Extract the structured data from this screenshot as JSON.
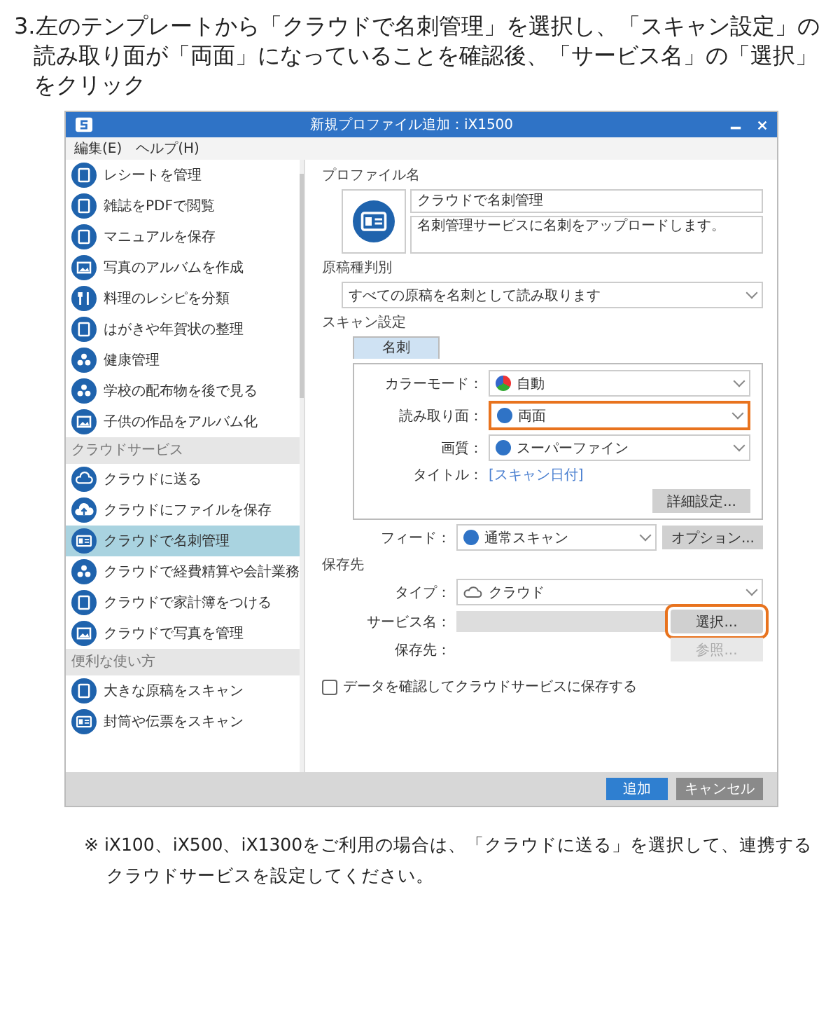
{
  "instruction": "3.左のテンプレートから「クラウドで名刺管理」を選択し、「スキャン設定」の読み取り面が「両面」になっていることを確認後、「サービス名」の「選択」をクリック",
  "window": {
    "title": "新規プロファイル追加：iX1500",
    "menu": [
      "編集(E)",
      "ヘルプ(H)"
    ]
  },
  "sidebar": [
    {
      "items": [
        {
          "label": "レシートを管理",
          "kind": "doc",
          "selected": false
        },
        {
          "label": "雑誌をPDFで閲覧",
          "kind": "doc",
          "selected": false
        },
        {
          "label": "マニュアルを保存",
          "kind": "doc",
          "selected": false
        },
        {
          "label": "写真のアルバムを作成",
          "kind": "photo",
          "selected": false
        },
        {
          "label": "料理のレシピを分類",
          "kind": "cutlery",
          "selected": false
        },
        {
          "label": "はがきや年賀状の整理",
          "kind": "doc",
          "selected": false
        },
        {
          "label": "健康管理",
          "kind": "people",
          "selected": false
        },
        {
          "label": "学校の配布物を後で見る",
          "kind": "people",
          "selected": false
        },
        {
          "label": "子供の作品をアルバム化",
          "kind": "photo",
          "selected": false
        }
      ]
    },
    {
      "header": "クラウドサービス",
      "items": [
        {
          "label": "クラウドに送る",
          "kind": "cloud",
          "selected": false
        },
        {
          "label": "クラウドにファイルを保存",
          "kind": "upload",
          "selected": false
        },
        {
          "label": "クラウドで名刺管理",
          "kind": "card",
          "selected": true
        },
        {
          "label": "クラウドで経費精算や会計業務",
          "kind": "people",
          "selected": false
        },
        {
          "label": "クラウドで家計簿をつける",
          "kind": "doc",
          "selected": false
        },
        {
          "label": "クラウドで写真を管理",
          "kind": "photo",
          "selected": false
        }
      ]
    },
    {
      "header": "便利な使い方",
      "items": [
        {
          "label": "大きな原稿をスキャン",
          "kind": "doc",
          "selected": false
        },
        {
          "label": "封筒や伝票をスキャン",
          "kind": "card",
          "selected": false
        }
      ]
    }
  ],
  "profile": {
    "heading": "プロファイル名",
    "name": "クラウドで名刺管理",
    "description": "名刺管理サービスに名刺をアップロードします。"
  },
  "document_type": {
    "heading": "原稿種判別",
    "value": "すべての原稿を名刺として読み取ります"
  },
  "scan_settings": {
    "heading": "スキャン設定",
    "tabs": [
      {
        "label": "名刺",
        "selected": true
      }
    ],
    "rows": [
      {
        "label": "カラーモード：",
        "kind": "select",
        "value": "自動",
        "highlighted": false
      },
      {
        "label": "読み取り面：",
        "kind": "select",
        "value": "両面",
        "highlighted": true
      },
      {
        "label": "画質：",
        "kind": "select",
        "value": "スーパーファイン",
        "highlighted": false
      },
      {
        "label": "タイトル：",
        "kind": "link",
        "value": "[スキャン日付]",
        "highlighted": false
      }
    ],
    "details_button": "詳細設定..."
  },
  "feed": {
    "label": "フィード：",
    "value": "通常スキャン",
    "button": "オプション..."
  },
  "destination": {
    "heading": "保存先",
    "rows": [
      {
        "label": "タイプ：",
        "kind": "select",
        "value": "クラウド"
      },
      {
        "label": "サービス名：",
        "kind": "field",
        "button": "選択...",
        "button_disabled": false,
        "highlighted": true
      },
      {
        "label": "保存先：",
        "kind": "blank",
        "button": "参照...",
        "button_disabled": true,
        "highlighted": false
      }
    ]
  },
  "confirm_checkbox": {
    "label": "データを確認してクラウドサービスに保存する",
    "checked": false
  },
  "footer_buttons": [
    {
      "label": "追加",
      "primary": true
    },
    {
      "label": "キャンセル",
      "primary": false
    }
  ],
  "note": "※ iX100、iX500、iX1300をご利用の場合は、「クラウドに送る」を選択して、連携するクラウドサービスを設定してください。"
}
